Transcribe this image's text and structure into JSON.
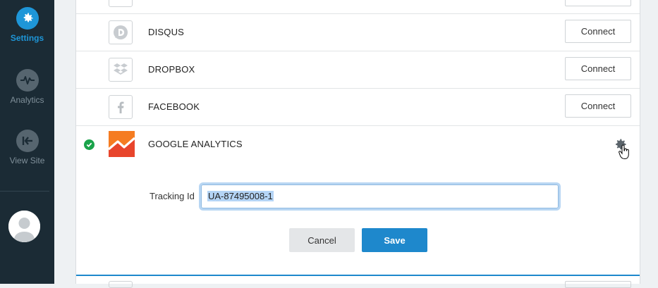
{
  "sidebar": {
    "items": [
      {
        "label": "Settings",
        "icon": "gear-icon",
        "active": true
      },
      {
        "label": "Analytics",
        "icon": "pulse-icon",
        "active": false
      },
      {
        "label": "View Site",
        "icon": "exit-arrow-icon",
        "active": false
      }
    ],
    "avatar_icon": "user-avatar-icon"
  },
  "services": [
    {
      "name": "DISQUS",
      "icon": "disqus-icon",
      "action": "Connect"
    },
    {
      "name": "DROPBOX",
      "icon": "dropbox-icon",
      "action": "Connect"
    },
    {
      "name": "FACEBOOK",
      "icon": "facebook-icon",
      "action": "Connect"
    }
  ],
  "google_analytics": {
    "name": "GOOGLE ANALYTICS",
    "connected": true,
    "status_icon": "check-circle-icon",
    "settings_icon": "gear-icon",
    "tracking_label": "Tracking Id",
    "tracking_value": "UA-87495008-1",
    "cancel_label": "Cancel",
    "save_label": "Save"
  },
  "colors": {
    "sidebar_bg": "#1b2b35",
    "accent": "#1e96d8",
    "save_button": "#1e88cc",
    "connected": "#1aa34a"
  }
}
